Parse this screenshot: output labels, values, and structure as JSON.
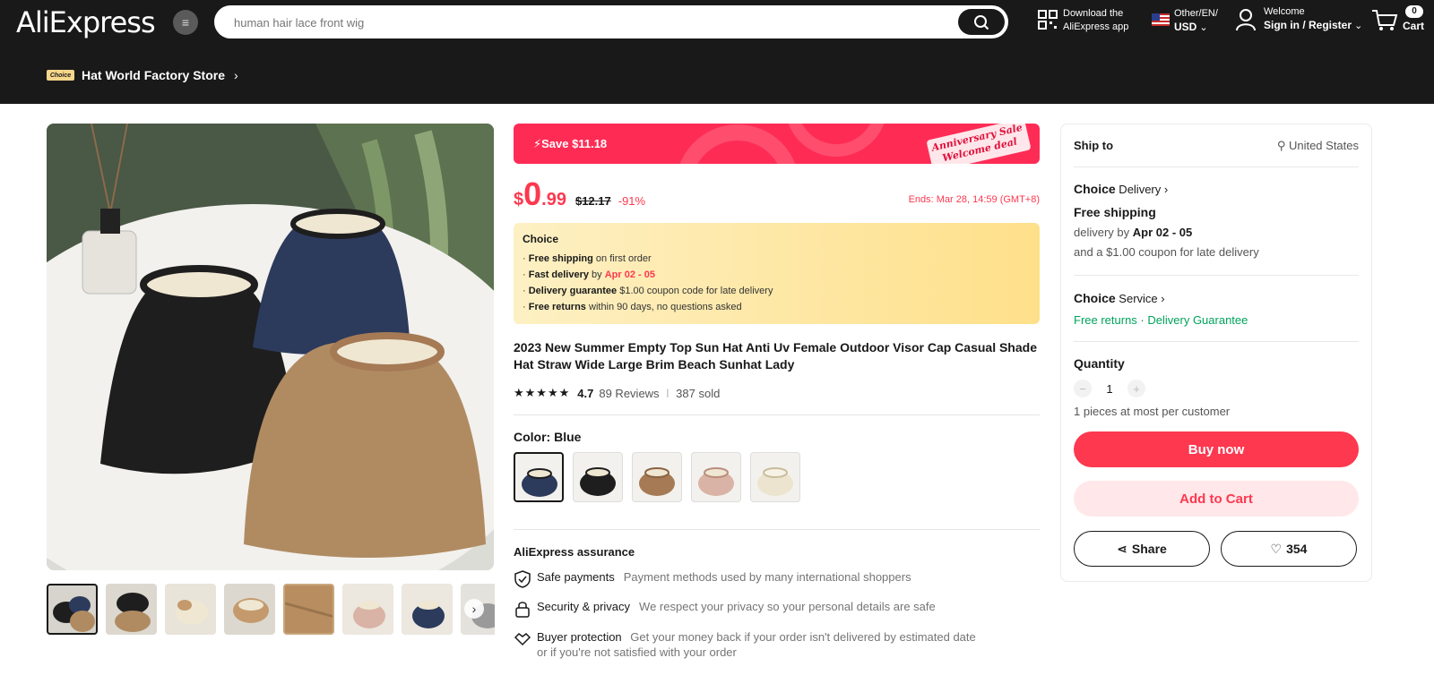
{
  "header": {
    "logo": "AliExpress",
    "search_placeholder": "human hair lace front wig",
    "app_line1": "Download the",
    "app_line2": "AliExpress app",
    "locale_line1": "Other/EN/",
    "locale_line2": "USD",
    "welcome": "Welcome",
    "signin": "Sign in / Register",
    "cart_count": "0",
    "cart_label": "Cart"
  },
  "store": {
    "badge": "Choice",
    "name": "Hat World Factory Store"
  },
  "banner": {
    "save": "Save $11.18",
    "tag_line1": "Anniversary Sale",
    "tag_line2": "Welcome deal"
  },
  "price": {
    "currency": "$",
    "integer": "0",
    "decimal": ".99",
    "original": "$12.17",
    "discount": "-91%",
    "ends": "Ends: Mar 28, 14:59 (GMT+8)"
  },
  "choice_box": {
    "title": "Choice",
    "lines": [
      {
        "bold": "Free shipping",
        "rest": " on first order"
      },
      {
        "bold": "Fast delivery",
        "rest": " by ",
        "red": "Apr 02 - 05"
      },
      {
        "bold": "Delivery guarantee",
        "rest": "  $1.00 coupon code for late delivery"
      },
      {
        "bold": "Free returns",
        "rest": "  within 90 days, no questions asked"
      }
    ]
  },
  "product": {
    "title": "2023 New Summer Empty Top Sun Hat Anti Uv Female Outdoor Visor Cap Casual Shade Hat Straw Wide Large Brim Beach Sunhat Lady",
    "stars": "★★★★★",
    "rating": "4.7",
    "reviews": "89 Reviews",
    "sold": "387 sold",
    "color_label": "Color: Blue",
    "swatch_colors": [
      "#2c3a5c",
      "#1e1e1e",
      "#a57a55",
      "#d9b3a5",
      "#ece4cf"
    ]
  },
  "assurance": {
    "title": "AliExpress assurance",
    "items": [
      {
        "name": "Safe payments",
        "desc": "Payment methods used by many international shoppers"
      },
      {
        "name": "Security & privacy",
        "desc": "We respect your privacy so your personal details are safe"
      },
      {
        "name": "Buyer protection",
        "desc": "Get your money back if your order isn't delivered by estimated date",
        "desc2": "or if you're not satisfied with your order"
      }
    ]
  },
  "sidebar": {
    "ship_to": "Ship to",
    "location": "United States",
    "choice_delivery_bold": "Choice",
    "choice_delivery_rest": " Delivery",
    "free_shipping": "Free shipping",
    "delivery_by": "delivery by ",
    "delivery_date": "Apr 02 - 05",
    "coupon": "and a $1.00 coupon for late delivery",
    "choice_service_bold": "Choice",
    "choice_service_rest": " Service",
    "free_returns": "Free returns",
    "dot": " · ",
    "delivery_guarantee": "Delivery Guarantee",
    "quantity_label": "Quantity",
    "qty_minus": "−",
    "qty_value": "1",
    "qty_plus": "+",
    "qty_limit": "1 pieces at most per customer",
    "buy_now": "Buy now",
    "add_to_cart": "Add to Cart",
    "share": "Share",
    "wishlist_count": "354"
  }
}
